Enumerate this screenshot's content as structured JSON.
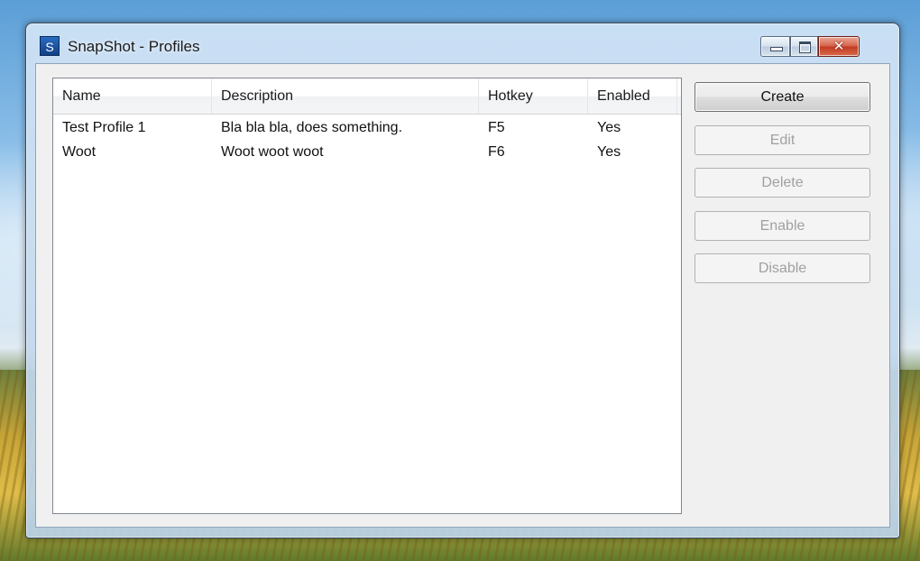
{
  "window": {
    "title": "SnapShot - Profiles",
    "icon_letter": "S",
    "controls": {
      "minimize": "minimize-icon",
      "maximize": "maximize-icon",
      "close_glyph": "✕"
    }
  },
  "profiles": {
    "columns": [
      "Name",
      "Description",
      "Hotkey",
      "Enabled"
    ],
    "rows": [
      [
        "Test Profile 1",
        "Bla bla bla, does something.",
        "F5",
        "Yes"
      ],
      [
        "Woot",
        "Woot woot woot",
        "F6",
        "Yes"
      ]
    ]
  },
  "actions": {
    "create": "Create",
    "edit": "Edit",
    "delete": "Delete",
    "enable": "Enable",
    "disable": "Disable"
  },
  "colors": {
    "close_button": "#c94a2e",
    "client_background": "#f0f0f0",
    "disabled_text": "#a0a0a0"
  }
}
